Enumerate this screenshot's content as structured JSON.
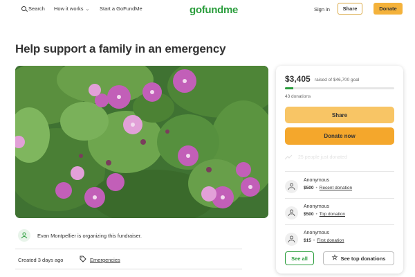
{
  "header": {
    "search_label": "Search",
    "how_label": "How it works",
    "start_label": "Start a GoFundMe",
    "logo_text": "gofundme",
    "signin_label": "Sign in",
    "share_label": "Share",
    "donate_label": "Donate"
  },
  "campaign": {
    "title": "Help support a family in an emergency",
    "organizer_text": "Evan Montpellier is organizing this fundraiser.",
    "created_text": "Created 3 days ago",
    "category": "Emergencies"
  },
  "donation_card": {
    "raised": "$3,405",
    "goal_text": "raised of $46,700 goal",
    "progress_fraction": 0.073,
    "donations_count": "43 donations",
    "share_label": "Share",
    "donate_label": "Donate now",
    "just_donated_text": "25 people just donated",
    "donations": [
      {
        "name": "Anonymous",
        "amount": "$500",
        "tag": "Recent donation"
      },
      {
        "name": "Anonymous",
        "amount": "$500",
        "tag": "Top donation"
      },
      {
        "name": "Anonymous",
        "amount": "$15",
        "tag": "First donation"
      }
    ],
    "see_all_label": "See all",
    "top_donations_label": "See top donations"
  },
  "colors": {
    "brand_green": "#2a9d3c",
    "donate_orange": "#f4a72c",
    "share_yellow": "#f8c565"
  },
  "icons": [
    "search-icon",
    "chevron-down-icon",
    "person-icon",
    "tag-icon",
    "trend-icon",
    "hand-heart-icon",
    "star-icon"
  ]
}
